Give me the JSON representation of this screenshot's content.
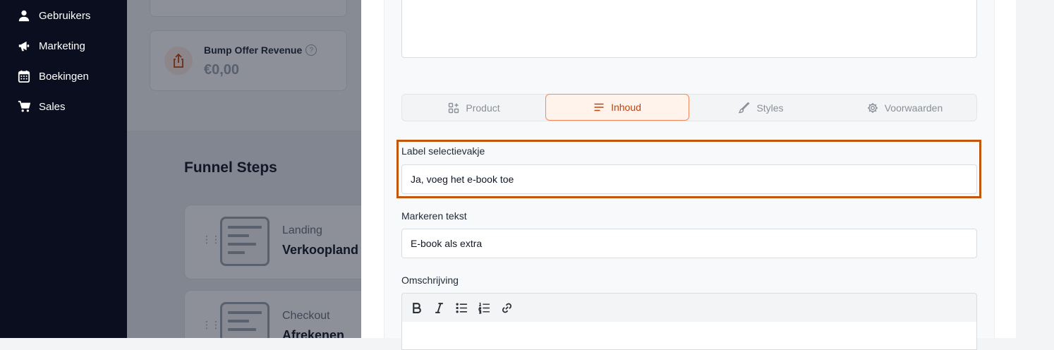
{
  "sidebar": {
    "items": [
      {
        "label": "Gebruikers",
        "icon": "user-icon"
      },
      {
        "label": "Marketing",
        "icon": "megaphone-icon"
      },
      {
        "label": "Boekingen",
        "icon": "calendar-icon"
      },
      {
        "label": "Sales",
        "icon": "cart-icon"
      }
    ]
  },
  "background": {
    "metric": {
      "title": "Bump Offer Revenue",
      "value": "€0,00",
      "icon": "share-icon"
    },
    "funnel_title": "Funnel Steps",
    "steps": [
      {
        "label": "Landing",
        "name": "Verkoopland"
      },
      {
        "label": "Checkout",
        "name": "Afrekenen"
      }
    ]
  },
  "panel": {
    "tabs": [
      {
        "label": "Product",
        "icon": "grid-plus-icon",
        "active": false
      },
      {
        "label": "Inhoud",
        "icon": "lines-icon",
        "active": true
      },
      {
        "label": "Styles",
        "icon": "brush-icon",
        "active": false
      },
      {
        "label": "Voorwaarden",
        "icon": "gear-icon",
        "active": false
      }
    ],
    "checkbox_label_field": {
      "label": "Label selectievakje",
      "value": "Ja, voeg het e-book toe"
    },
    "highlight_field": {
      "label": "Markeren tekst",
      "value": "E-book als extra"
    },
    "description_field": {
      "label": "Omschrijving"
    },
    "toolbar": [
      "bold-icon",
      "italic-icon",
      "bullet-list-icon",
      "numbered-list-icon",
      "link-icon"
    ]
  },
  "colors": {
    "accent": "#c2410c",
    "accent_bg": "#fff3ec",
    "highlight_border": "#c2570c",
    "sidebar_bg": "#0b0e1f"
  }
}
